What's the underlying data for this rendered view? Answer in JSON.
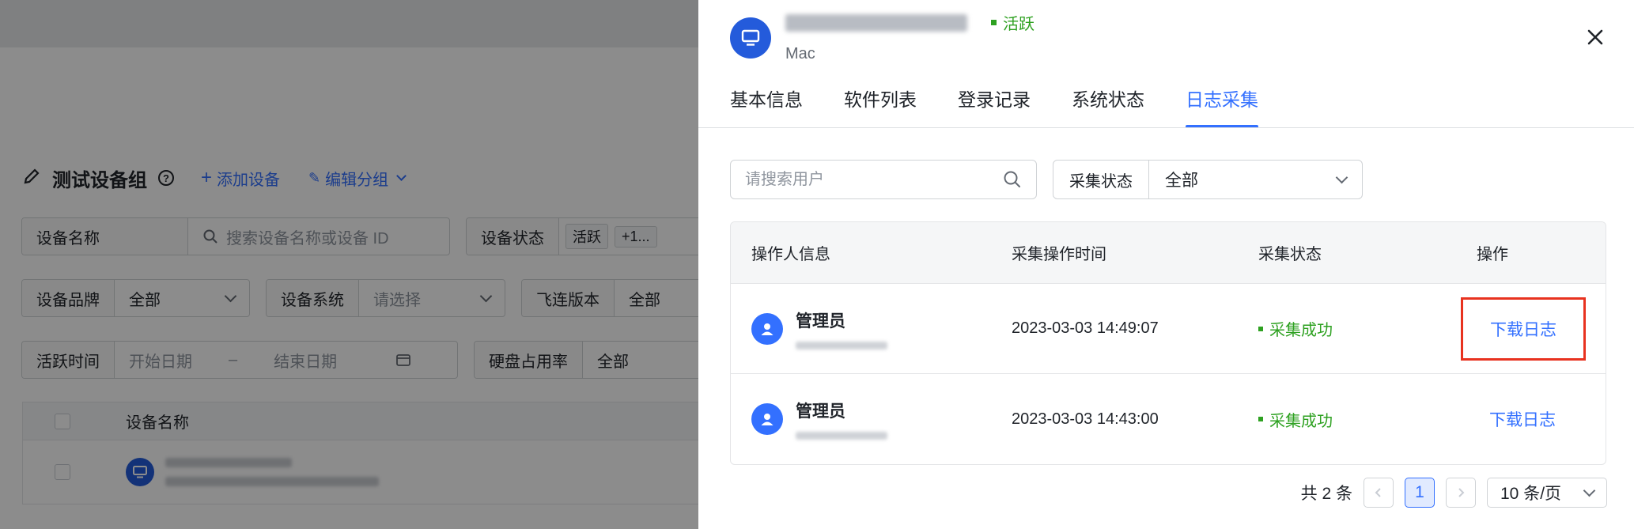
{
  "background": {
    "group_title": "测试设备组",
    "add_device": "添加设备",
    "edit_group": "编辑分组",
    "filters": {
      "device_name": {
        "label": "设备名称",
        "placeholder": "搜索设备名称或设备 ID"
      },
      "device_status": {
        "label": "设备状态",
        "tag": "活跃",
        "more": "+1..."
      },
      "device_brand": {
        "label": "设备品牌",
        "value": "全部"
      },
      "device_os": {
        "label": "设备系统",
        "placeholder": "请选择"
      },
      "feilian_version": {
        "label": "飞连版本",
        "value": "全部"
      },
      "active_time": {
        "label": "活跃时间",
        "start_placeholder": "开始日期",
        "separator": "–",
        "end_placeholder": "结束日期"
      },
      "disk_usage": {
        "label": "硬盘占用率",
        "value": "全部"
      }
    },
    "table": {
      "header": "设备名称"
    }
  },
  "drawer": {
    "status": "活跃",
    "os": "Mac",
    "tabs": [
      "基本信息",
      "软件列表",
      "登录记录",
      "系统状态",
      "日志采集"
    ],
    "active_tab": "日志采集",
    "search_placeholder": "请搜索用户",
    "collect_filter": {
      "label": "采集状态",
      "value": "全部"
    },
    "table": {
      "columns": [
        "操作人信息",
        "采集操作时间",
        "采集状态",
        "操作"
      ],
      "rows": [
        {
          "user": "管理员",
          "time": "2023-03-03 14:49:07",
          "status": "采集成功",
          "action": "下载日志"
        },
        {
          "user": "管理员",
          "time": "2023-03-03 14:43:00",
          "status": "采集成功",
          "action": "下载日志"
        }
      ]
    },
    "pagination": {
      "total": "共 2 条",
      "current_page": "1",
      "page_size": "10 条/页"
    }
  },
  "colors": {
    "accent": "#3370ff",
    "success": "#2ea121",
    "highlight_box": "#e8321f"
  },
  "icons": [
    "computer-icon",
    "close-icon",
    "search-icon",
    "chevron-down-icon",
    "user-icon",
    "edit-icon",
    "help-icon",
    "calendar-icon"
  ]
}
